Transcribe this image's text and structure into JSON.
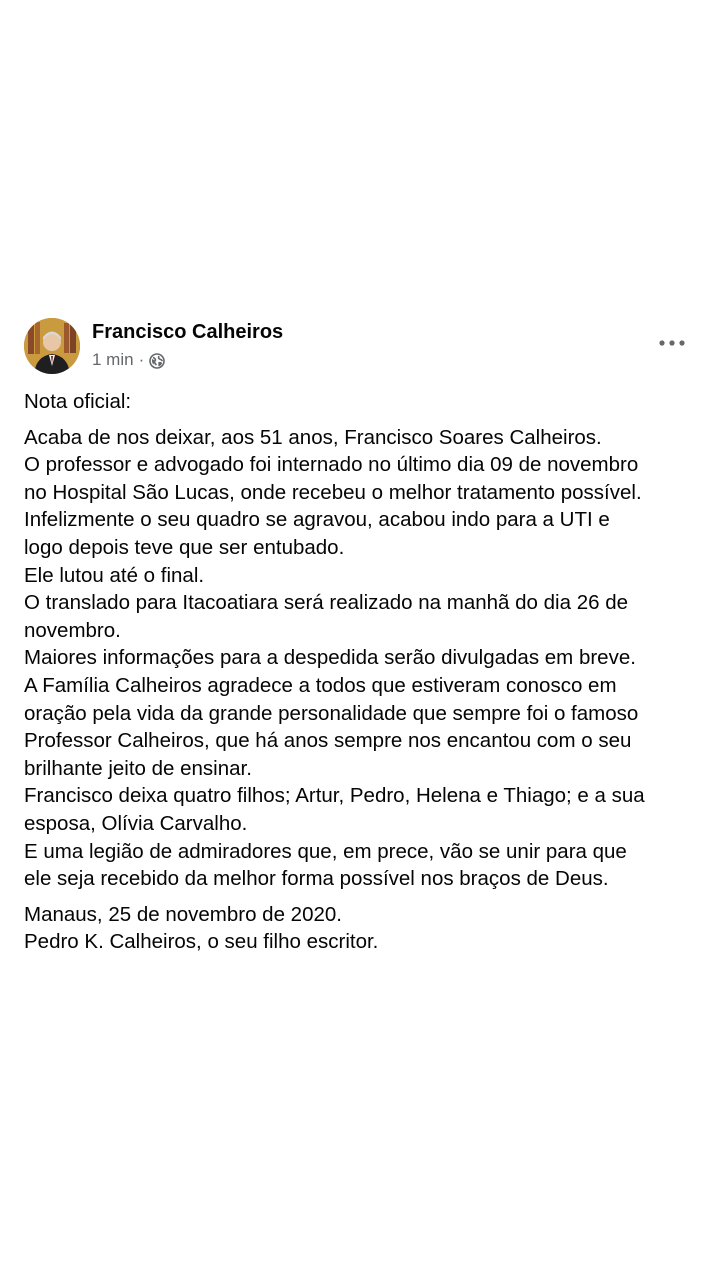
{
  "post": {
    "author": "Francisco Calheiros",
    "time": "1 min",
    "separator": "·",
    "privacy_icon": "globe-icon",
    "more_icon": "more-options-icon",
    "paragraphs": [
      [
        "Nota oficial:"
      ],
      [
        "Acaba de nos deixar, aos 51 anos, Francisco Soares Calheiros.",
        "O professor e advogado foi internado no último dia 09 de novembro",
        "no Hospital São Lucas, onde recebeu o melhor tratamento possível.",
        "Infelizmente o seu quadro se agravou, acabou indo para a UTI e",
        "logo depois teve que ser entubado.",
        "Ele lutou até o final.",
        "O translado para Itacoatiara será realizado na manhã do dia 26 de",
        "novembro.",
        "Maiores informações para a despedida serão divulgadas em breve.",
        "A Família Calheiros agradece a todos que estiveram conosco em",
        "oração pela vida da grande personalidade que sempre foi o famoso",
        "Professor Calheiros, que há anos sempre nos encantou com o seu",
        "brilhante jeito de ensinar.",
        "Francisco deixa quatro filhos; Artur, Pedro, Helena e Thiago; e a sua",
        "esposa, Olívia Carvalho.",
        "E uma legião de admiradores que, em prece, vão se unir para que",
        "ele seja recebido da melhor forma possível nos braços de Deus."
      ],
      [
        "Manaus, 25 de novembro de 2020.",
        "Pedro K. Calheiros, o seu filho escritor."
      ]
    ]
  }
}
